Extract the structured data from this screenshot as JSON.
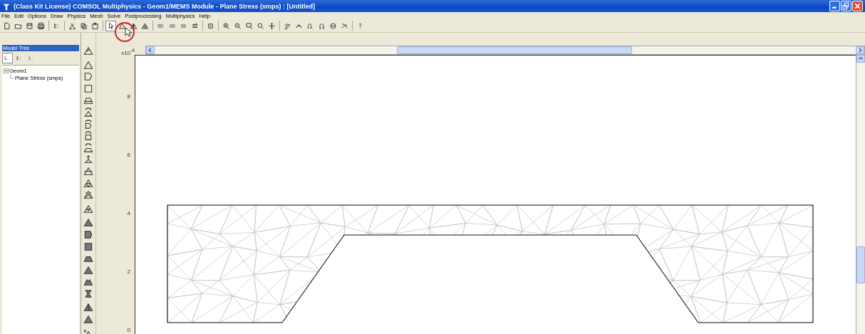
{
  "window": {
    "title": "(Class Kit License) COMSOL Multiphysics - Geom1/MEMS Module - Plane Stress (smps) : [Untitled]"
  },
  "menu": [
    "File",
    "Edit",
    "Options",
    "Draw",
    "Physics",
    "Mesh",
    "Solve",
    "Postprocessing",
    "Multiphysics",
    "Help"
  ],
  "model_tree": {
    "title": "Model Tree",
    "items": [
      {
        "label": "Geom1",
        "expanded": true,
        "children": [
          {
            "label": "Plane Stress (smps)"
          }
        ]
      }
    ]
  },
  "plot": {
    "axis_scale": "x10$^{-4}$",
    "y_ticks": [
      "8",
      "6",
      "4",
      "2",
      "0"
    ]
  }
}
